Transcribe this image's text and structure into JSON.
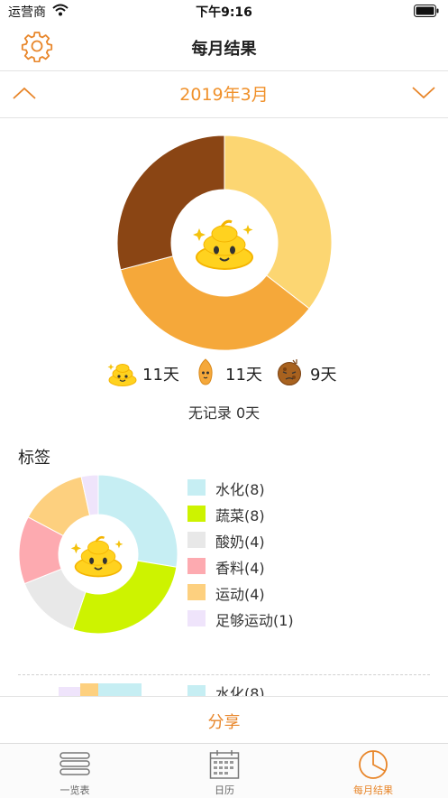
{
  "status_bar": {
    "carrier": "运营商",
    "time": "下午9:16"
  },
  "header": {
    "title": "每月结果",
    "settings_icon": "gear-icon"
  },
  "month_nav": {
    "label": "2019年3月",
    "prev_icon": "chevron-up-icon",
    "next_icon": "chevron-down-icon"
  },
  "summary": {
    "legend": [
      {
        "icon": "happy-poop-icon",
        "label": "11天"
      },
      {
        "icon": "tall-poop-icon",
        "label": "11天"
      },
      {
        "icon": "brown-poop-icon",
        "label": "9天"
      }
    ],
    "no_record": "无记录 0天"
  },
  "tags": {
    "title": "标签",
    "items": [
      {
        "label": "水化(8)"
      },
      {
        "label": "蔬菜(8)"
      },
      {
        "label": "酸奶(4)"
      },
      {
        "label": "香料(4)"
      },
      {
        "label": "运动(4)"
      },
      {
        "label": "足够运动(1)"
      }
    ],
    "peek_label": "水化(8)"
  },
  "share": {
    "label": "分享"
  },
  "tab_bar": {
    "tabs": [
      {
        "label": "一览表",
        "icon": "list-icon"
      },
      {
        "label": "日历",
        "icon": "calendar-icon"
      },
      {
        "label": "每月结果",
        "icon": "pie-chart-icon"
      }
    ]
  },
  "chart_data": [
    {
      "type": "pie",
      "categories": [
        "happy",
        "tall",
        "brown"
      ],
      "values": [
        11,
        11,
        9
      ],
      "colors": [
        "#fcd672",
        "#f5a83a",
        "#8a4514"
      ],
      "unit": "天"
    },
    {
      "type": "pie",
      "categories": [
        "水化",
        "蔬菜",
        "酸奶",
        "香料",
        "运动",
        "足够运动"
      ],
      "values": [
        8,
        8,
        4,
        4,
        4,
        1
      ],
      "colors": [
        "#c6eef3",
        "#cdf300",
        "#e8e8e8",
        "#fdaab0",
        "#fdd07f",
        "#efe4fb"
      ]
    }
  ]
}
